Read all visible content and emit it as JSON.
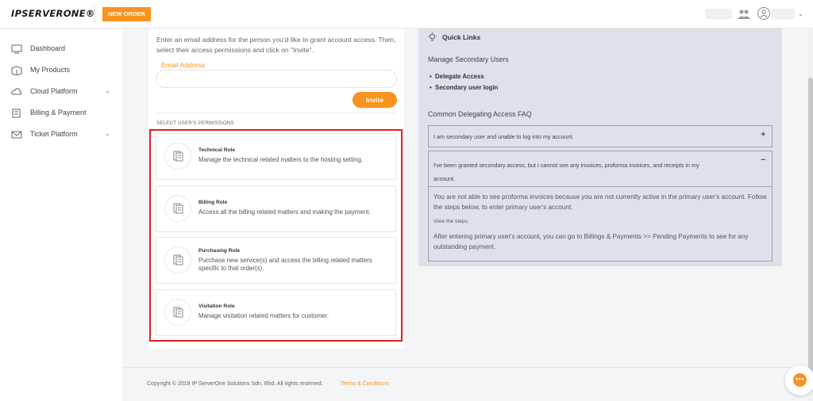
{
  "header": {
    "logo_text": "IPSERVERONE®",
    "new_order_label": "NEW ORDER",
    "dropdown_caret": "⌄"
  },
  "sidebar": {
    "items": [
      {
        "label": "Dashboard",
        "icon": "monitor-icon"
      },
      {
        "label": "My Products",
        "icon": "box-icon"
      },
      {
        "label": "Cloud Platform",
        "icon": "cloud-icon",
        "chevron": "⌄"
      },
      {
        "label": "Billing & Payment",
        "icon": "invoice-icon"
      },
      {
        "label": "Ticket Platform",
        "icon": "mail-icon",
        "chevron": "⌄"
      }
    ]
  },
  "invite": {
    "intro": "Enter an email address for the person you'd like to grant account access. Then, select their access permissions and click on \"Invite\".",
    "email_label": "Email Address",
    "email_value": "",
    "button": "Invite"
  },
  "permissions": {
    "title": "SELECT USER'S PERMISSIONS",
    "roles": [
      {
        "title": "Technical Role",
        "desc": "Manage the technical related matters to the hosting setting."
      },
      {
        "title": "Billing Role",
        "desc": "Access all the billing related matters and making the payment."
      },
      {
        "title": "Purchasing Role",
        "desc": "Purchase new service(s) and access the billing related matters specific to that order(s)."
      },
      {
        "title": "Visitation Role",
        "desc": "Manage visitation related matters for customer."
      }
    ]
  },
  "quick_links": {
    "title": "Quick Links",
    "section_title": "Manage Secondary Users",
    "links": [
      "Delegate Access",
      "Secondary user login"
    ]
  },
  "faq": {
    "title": "Common Delegating Access FAQ",
    "items": [
      {
        "question": "I am secondary user and unable to log into my account.",
        "toggle": "+"
      },
      {
        "question": "I've been granted secondary access, but I cannot see any invoices, proforma invoices, and receipts in my account.",
        "toggle": "−",
        "answer_1": "You are not able to see proforma invoices because you are not currently active in the primary user's account. Follow the steps below, to enter primary user's account.",
        "steps_link": "View the steps.",
        "answer_2": "After entering primary user's account, you can go to Billings & Payments >> Pending Payments to see for any outstanding payment."
      }
    ]
  },
  "footer": {
    "copyright": "Copyright © 2019 IP ServerOne Solutions Sdn. Bhd. All rights reserved.",
    "terms": "Terms & Conditions"
  },
  "colors": {
    "accent": "#f7931e",
    "highlight_border": "#e02020",
    "panel_bg": "#dde2ea"
  }
}
